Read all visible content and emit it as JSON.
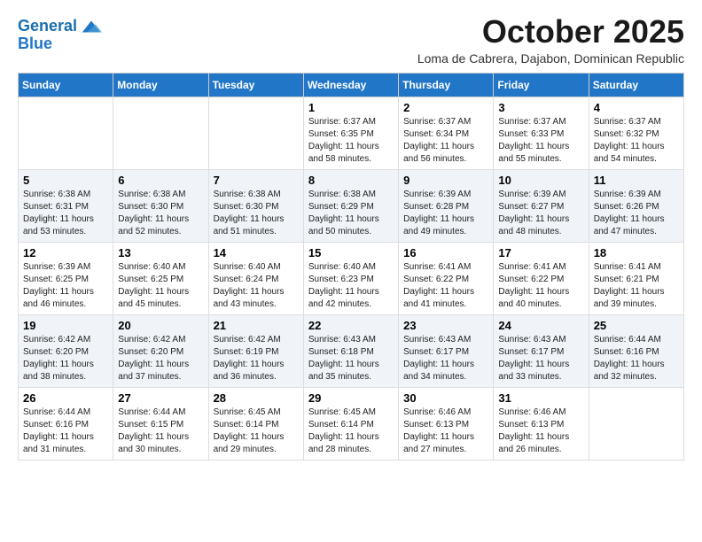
{
  "header": {
    "logo_line1": "General",
    "logo_line2": "Blue",
    "month": "October 2025",
    "location": "Loma de Cabrera, Dajabon, Dominican Republic"
  },
  "weekdays": [
    "Sunday",
    "Monday",
    "Tuesday",
    "Wednesday",
    "Thursday",
    "Friday",
    "Saturday"
  ],
  "weeks": [
    [
      {
        "day": "",
        "info": ""
      },
      {
        "day": "",
        "info": ""
      },
      {
        "day": "",
        "info": ""
      },
      {
        "day": "1",
        "info": "Sunrise: 6:37 AM\nSunset: 6:35 PM\nDaylight: 11 hours\nand 58 minutes."
      },
      {
        "day": "2",
        "info": "Sunrise: 6:37 AM\nSunset: 6:34 PM\nDaylight: 11 hours\nand 56 minutes."
      },
      {
        "day": "3",
        "info": "Sunrise: 6:37 AM\nSunset: 6:33 PM\nDaylight: 11 hours\nand 55 minutes."
      },
      {
        "day": "4",
        "info": "Sunrise: 6:37 AM\nSunset: 6:32 PM\nDaylight: 11 hours\nand 54 minutes."
      }
    ],
    [
      {
        "day": "5",
        "info": "Sunrise: 6:38 AM\nSunset: 6:31 PM\nDaylight: 11 hours\nand 53 minutes."
      },
      {
        "day": "6",
        "info": "Sunrise: 6:38 AM\nSunset: 6:30 PM\nDaylight: 11 hours\nand 52 minutes."
      },
      {
        "day": "7",
        "info": "Sunrise: 6:38 AM\nSunset: 6:30 PM\nDaylight: 11 hours\nand 51 minutes."
      },
      {
        "day": "8",
        "info": "Sunrise: 6:38 AM\nSunset: 6:29 PM\nDaylight: 11 hours\nand 50 minutes."
      },
      {
        "day": "9",
        "info": "Sunrise: 6:39 AM\nSunset: 6:28 PM\nDaylight: 11 hours\nand 49 minutes."
      },
      {
        "day": "10",
        "info": "Sunrise: 6:39 AM\nSunset: 6:27 PM\nDaylight: 11 hours\nand 48 minutes."
      },
      {
        "day": "11",
        "info": "Sunrise: 6:39 AM\nSunset: 6:26 PM\nDaylight: 11 hours\nand 47 minutes."
      }
    ],
    [
      {
        "day": "12",
        "info": "Sunrise: 6:39 AM\nSunset: 6:25 PM\nDaylight: 11 hours\nand 46 minutes."
      },
      {
        "day": "13",
        "info": "Sunrise: 6:40 AM\nSunset: 6:25 PM\nDaylight: 11 hours\nand 45 minutes."
      },
      {
        "day": "14",
        "info": "Sunrise: 6:40 AM\nSunset: 6:24 PM\nDaylight: 11 hours\nand 43 minutes."
      },
      {
        "day": "15",
        "info": "Sunrise: 6:40 AM\nSunset: 6:23 PM\nDaylight: 11 hours\nand 42 minutes."
      },
      {
        "day": "16",
        "info": "Sunrise: 6:41 AM\nSunset: 6:22 PM\nDaylight: 11 hours\nand 41 minutes."
      },
      {
        "day": "17",
        "info": "Sunrise: 6:41 AM\nSunset: 6:22 PM\nDaylight: 11 hours\nand 40 minutes."
      },
      {
        "day": "18",
        "info": "Sunrise: 6:41 AM\nSunset: 6:21 PM\nDaylight: 11 hours\nand 39 minutes."
      }
    ],
    [
      {
        "day": "19",
        "info": "Sunrise: 6:42 AM\nSunset: 6:20 PM\nDaylight: 11 hours\nand 38 minutes."
      },
      {
        "day": "20",
        "info": "Sunrise: 6:42 AM\nSunset: 6:20 PM\nDaylight: 11 hours\nand 37 minutes."
      },
      {
        "day": "21",
        "info": "Sunrise: 6:42 AM\nSunset: 6:19 PM\nDaylight: 11 hours\nand 36 minutes."
      },
      {
        "day": "22",
        "info": "Sunrise: 6:43 AM\nSunset: 6:18 PM\nDaylight: 11 hours\nand 35 minutes."
      },
      {
        "day": "23",
        "info": "Sunrise: 6:43 AM\nSunset: 6:17 PM\nDaylight: 11 hours\nand 34 minutes."
      },
      {
        "day": "24",
        "info": "Sunrise: 6:43 AM\nSunset: 6:17 PM\nDaylight: 11 hours\nand 33 minutes."
      },
      {
        "day": "25",
        "info": "Sunrise: 6:44 AM\nSunset: 6:16 PM\nDaylight: 11 hours\nand 32 minutes."
      }
    ],
    [
      {
        "day": "26",
        "info": "Sunrise: 6:44 AM\nSunset: 6:16 PM\nDaylight: 11 hours\nand 31 minutes."
      },
      {
        "day": "27",
        "info": "Sunrise: 6:44 AM\nSunset: 6:15 PM\nDaylight: 11 hours\nand 30 minutes."
      },
      {
        "day": "28",
        "info": "Sunrise: 6:45 AM\nSunset: 6:14 PM\nDaylight: 11 hours\nand 29 minutes."
      },
      {
        "day": "29",
        "info": "Sunrise: 6:45 AM\nSunset: 6:14 PM\nDaylight: 11 hours\nand 28 minutes."
      },
      {
        "day": "30",
        "info": "Sunrise: 6:46 AM\nSunset: 6:13 PM\nDaylight: 11 hours\nand 27 minutes."
      },
      {
        "day": "31",
        "info": "Sunrise: 6:46 AM\nSunset: 6:13 PM\nDaylight: 11 hours\nand 26 minutes."
      },
      {
        "day": "",
        "info": ""
      }
    ]
  ]
}
